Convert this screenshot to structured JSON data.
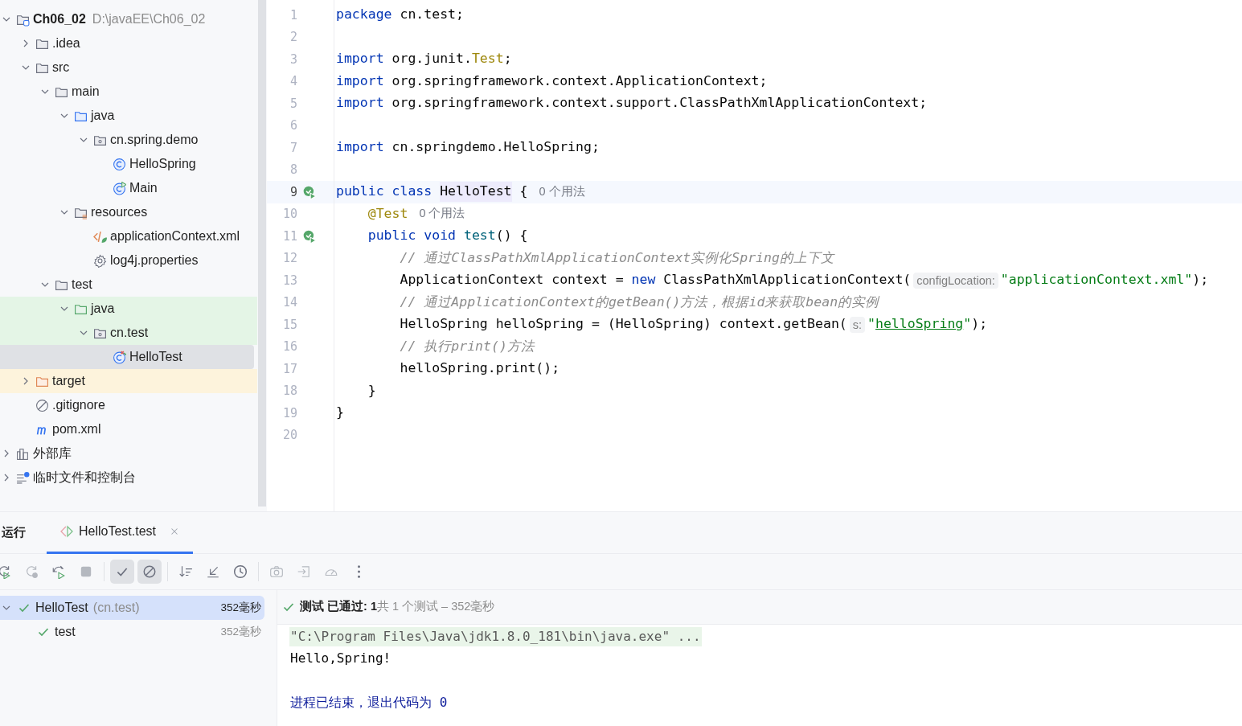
{
  "project_tree": [
    {
      "label": "Ch06_02",
      "path": "D:\\javaEE\\Ch06_02",
      "kind": "project",
      "expanded": true,
      "selected": false,
      "children": [
        {
          "label": ".idea",
          "kind": "folder",
          "expanded": false,
          "selected": false
        },
        {
          "label": "src",
          "kind": "folder",
          "expanded": true,
          "selected": false,
          "children": [
            {
              "label": "main",
              "kind": "folder",
              "expanded": true,
              "selected": false,
              "children": [
                {
                  "label": "java",
                  "kind": "source-folder",
                  "expanded": true,
                  "selected": false,
                  "children": [
                    {
                      "label": "cn.spring.demo",
                      "kind": "package",
                      "expanded": true,
                      "selected": false,
                      "children": [
                        {
                          "label": "HelloSpring",
                          "kind": "class",
                          "selected": false
                        },
                        {
                          "label": "Main",
                          "kind": "main-class",
                          "selected": false
                        }
                      ]
                    }
                  ]
                },
                {
                  "label": "resources",
                  "kind": "resources",
                  "expanded": true,
                  "selected": false,
                  "children": [
                    {
                      "label": "applicationContext.xml",
                      "kind": "xml",
                      "selected": false
                    },
                    {
                      "label": "log4j.properties",
                      "kind": "properties",
                      "selected": false
                    }
                  ]
                }
              ]
            },
            {
              "label": "test",
              "kind": "folder",
              "expanded": true,
              "selected": false,
              "children": [
                {
                  "label": "java",
                  "kind": "test-folder",
                  "expanded": true,
                  "selected": false,
                  "color": "#e4f5e6",
                  "children": [
                    {
                      "label": "cn.test",
                      "kind": "package",
                      "expanded": true,
                      "selected": false,
                      "color": "#e4f5e6",
                      "children": [
                        {
                          "label": "HelloTest",
                          "kind": "test-class",
                          "selected": true
                        }
                      ]
                    }
                  ]
                }
              ]
            }
          ]
        },
        {
          "label": "target",
          "kind": "excluded-folder",
          "expanded": false,
          "selected": false,
          "color": "#fdf3dc"
        },
        {
          "label": ".gitignore",
          "kind": "gitignore",
          "selected": false
        },
        {
          "label": "pom.xml",
          "kind": "maven",
          "selected": false
        }
      ]
    },
    {
      "label": "外部库",
      "kind": "library",
      "expanded": false,
      "selected": false
    },
    {
      "label": "临时文件和控制台",
      "kind": "scratch",
      "expanded": false,
      "selected": false
    }
  ],
  "editor": {
    "lines": [
      {
        "number": "1",
        "run": false,
        "selected": false,
        "tokens": [
          {
            "kind": "kw",
            "text": "package"
          },
          {
            "kind": "plain",
            "text": " cn.test;"
          }
        ]
      },
      {
        "number": "2",
        "run": false,
        "selected": false
      },
      {
        "number": "3",
        "run": false,
        "selected": false,
        "tokens": [
          {
            "kind": "kw",
            "text": "import"
          },
          {
            "kind": "plain",
            "text": " org.junit."
          },
          {
            "kind": "ann",
            "text": "Test"
          },
          {
            "kind": "plain",
            "text": ";"
          }
        ]
      },
      {
        "number": "4",
        "run": false,
        "selected": false,
        "tokens": [
          {
            "kind": "kw",
            "text": "import"
          },
          {
            "kind": "plain",
            "text": " org.springframework.context.ApplicationContext;"
          }
        ]
      },
      {
        "number": "5",
        "run": false,
        "selected": false,
        "tokens": [
          {
            "kind": "kw",
            "text": "import"
          },
          {
            "kind": "plain",
            "text": " org.springframework.context.support.ClassPathXmlApplicationContext;"
          }
        ]
      },
      {
        "number": "6",
        "run": false,
        "selected": false
      },
      {
        "number": "7",
        "run": false,
        "selected": false,
        "tokens": [
          {
            "kind": "kw",
            "text": "import"
          },
          {
            "kind": "plain",
            "text": " cn.springdemo.HelloSpring;"
          }
        ]
      },
      {
        "number": "8",
        "run": false,
        "selected": false
      },
      {
        "number": "9",
        "run": true,
        "selected": true,
        "tokens": [
          {
            "kind": "kw",
            "text": "public class "
          },
          {
            "kind": "decl",
            "text": "HelloTest"
          },
          {
            "kind": "plain",
            "text": " {"
          },
          {
            "kind": "usage",
            "text": "0 个用法"
          }
        ]
      },
      {
        "number": "10",
        "run": false,
        "selected": false,
        "tokens": [
          {
            "kind": "ann",
            "text": "    @Test"
          },
          {
            "kind": "usage",
            "text": "0 个用法"
          }
        ]
      },
      {
        "number": "11",
        "run": true,
        "selected": false,
        "tokens": [
          {
            "kind": "kw",
            "text": "    public void "
          },
          {
            "kind": "method",
            "text": "test"
          },
          {
            "kind": "plain",
            "text": "() {"
          }
        ]
      },
      {
        "number": "12",
        "run": false,
        "selected": false,
        "tokens": [
          {
            "kind": "comment",
            "text": "        // 通过ClassPathXmlApplicationContext实例化Spring的上下文"
          }
        ]
      },
      {
        "number": "13",
        "run": false,
        "selected": false,
        "tokens": [
          {
            "kind": "plain",
            "text": "        ApplicationContext context = "
          },
          {
            "kind": "kw",
            "text": "new"
          },
          {
            "kind": "plain",
            "text": " ClassPathXmlApplicationContext("
          },
          {
            "kind": "hint",
            "text": "configLocation:"
          },
          {
            "kind": "str",
            "text": "\"applicationContext.xml\""
          },
          {
            "kind": "plain",
            "text": ");"
          }
        ]
      },
      {
        "number": "14",
        "run": false,
        "selected": false,
        "tokens": [
          {
            "kind": "comment",
            "text": "        // 通过ApplicationContext的getBean()方法，根据id来获取bean的实例"
          }
        ]
      },
      {
        "number": "15",
        "run": false,
        "selected": false,
        "tokens": [
          {
            "kind": "plain",
            "text": "        HelloSpring helloSpring = (HelloSpring) context.getBean("
          },
          {
            "kind": "hint",
            "text": "s:"
          },
          {
            "kind": "str",
            "text": "\""
          },
          {
            "kind": "strlink",
            "text": "helloSpring"
          },
          {
            "kind": "str",
            "text": "\""
          },
          {
            "kind": "plain",
            "text": ");"
          }
        ]
      },
      {
        "number": "16",
        "run": false,
        "selected": false,
        "tokens": [
          {
            "kind": "comment",
            "text": "        // 执行print()方法"
          }
        ]
      },
      {
        "number": "17",
        "run": false,
        "selected": false,
        "tokens": [
          {
            "kind": "plain",
            "text": "        helloSpring.print();"
          }
        ]
      },
      {
        "number": "18",
        "run": false,
        "selected": false,
        "tokens": [
          {
            "kind": "plain",
            "text": "    }"
          }
        ]
      },
      {
        "number": "19",
        "run": false,
        "selected": false,
        "tokens": [
          {
            "kind": "plain",
            "text": "}"
          }
        ]
      },
      {
        "number": "20",
        "run": false,
        "selected": false
      }
    ]
  },
  "run_panel": {
    "title": "运行",
    "tabs": [
      {
        "label": "HelloTest.test",
        "selected": true
      }
    ],
    "toolbar": [
      {
        "kind": "rerun",
        "on": false,
        "disabled": false
      },
      {
        "kind": "rerun-failed",
        "on": false,
        "disabled": true
      },
      {
        "kind": "auto-rerun",
        "on": false,
        "disabled": false
      },
      {
        "kind": "stop",
        "on": false,
        "disabled": true
      },
      {
        "kind": "show-passed",
        "on": true,
        "disabled": false
      },
      {
        "kind": "show-ignored",
        "on": true,
        "disabled": false
      },
      {
        "kind": "sort",
        "on": false,
        "disabled": false
      },
      {
        "kind": "collapse",
        "on": false,
        "disabled": false
      },
      {
        "kind": "history",
        "on": false,
        "disabled": false
      },
      {
        "kind": "screenshot",
        "on": false,
        "disabled": true
      },
      {
        "kind": "import",
        "on": false,
        "disabled": true
      },
      {
        "kind": "coverage",
        "on": false,
        "disabled": true
      },
      {
        "kind": "more",
        "on": false,
        "disabled": false
      }
    ],
    "tests": [
      {
        "name": "HelloTest",
        "package": "(cn.test)",
        "time": "352毫秒",
        "selected": true,
        "expanded": true,
        "children": [
          {
            "name": "test",
            "time": "352毫秒",
            "selected": false
          }
        ]
      }
    ],
    "status": "**测试 已通过: 1**共 1 个测试 – 352毫秒",
    "console": [
      {
        "kind": "command",
        "text": "\"C:\\Program Files\\Java\\jdk1.8.0_181\\bin\\java.exe\" ..."
      },
      {
        "kind": "output",
        "text": "Hello,Spring!"
      },
      {
        "kind": "blank"
      },
      {
        "kind": "system",
        "text": "进程已结束，退出代码为 0"
      }
    ]
  }
}
